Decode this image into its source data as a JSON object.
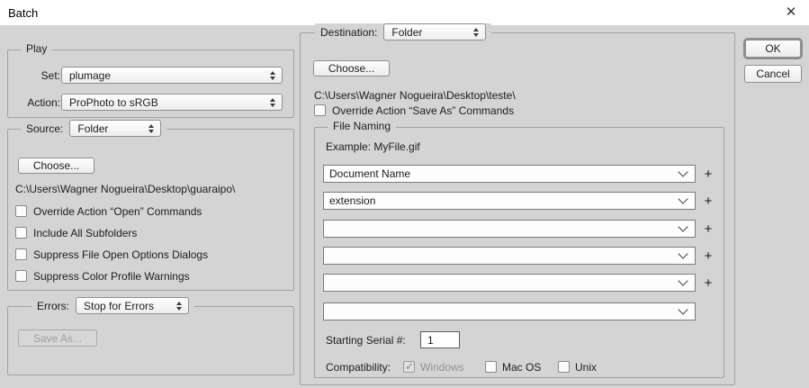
{
  "window": {
    "title": "Batch",
    "close_glyph": "✕"
  },
  "actions": {
    "ok": "OK",
    "cancel": "Cancel"
  },
  "play": {
    "legend": "Play",
    "set_label": "Set:",
    "set_value": "plumage",
    "action_label": "Action:",
    "action_value": "ProPhoto to sRGB"
  },
  "source": {
    "label": "Source:",
    "value": "Folder",
    "choose_label": "Choose...",
    "path": "C:\\Users\\Wagner Nogueira\\Desktop\\guaraipo\\",
    "checkboxes": [
      {
        "label": "Override Action “Open” Commands",
        "checked": false
      },
      {
        "label": "Include All Subfolders",
        "checked": false
      },
      {
        "label": "Suppress File Open Options Dialogs",
        "checked": false
      },
      {
        "label": "Suppress Color Profile Warnings",
        "checked": false
      }
    ]
  },
  "errors": {
    "label": "Errors:",
    "value": "Stop for Errors",
    "save_as_label": "Save As...",
    "save_as_enabled": false
  },
  "destination": {
    "label": "Destination:",
    "value": "Folder",
    "choose_label": "Choose...",
    "path": "C:\\Users\\Wagner Nogueira\\Desktop\\teste\\",
    "override_label": "Override Action “Save As” Commands",
    "override_checked": false
  },
  "file_naming": {
    "legend": "File Naming",
    "example": "Example: MyFile.gif",
    "plus_glyph": "+",
    "fields": [
      {
        "value": "Document Name",
        "has_plus": true
      },
      {
        "value": "extension",
        "has_plus": true
      },
      {
        "value": "",
        "has_plus": true
      },
      {
        "value": "",
        "has_plus": true
      },
      {
        "value": "",
        "has_plus": true
      },
      {
        "value": "",
        "has_plus": false
      }
    ],
    "serial_label": "Starting Serial #:",
    "serial_value": "1",
    "compatibility_label": "Compatibility:",
    "compatibility": [
      {
        "label": "Windows",
        "checked": true,
        "enabled": false
      },
      {
        "label": "Mac OS",
        "checked": false,
        "enabled": true
      },
      {
        "label": "Unix",
        "checked": false,
        "enabled": true
      }
    ]
  }
}
